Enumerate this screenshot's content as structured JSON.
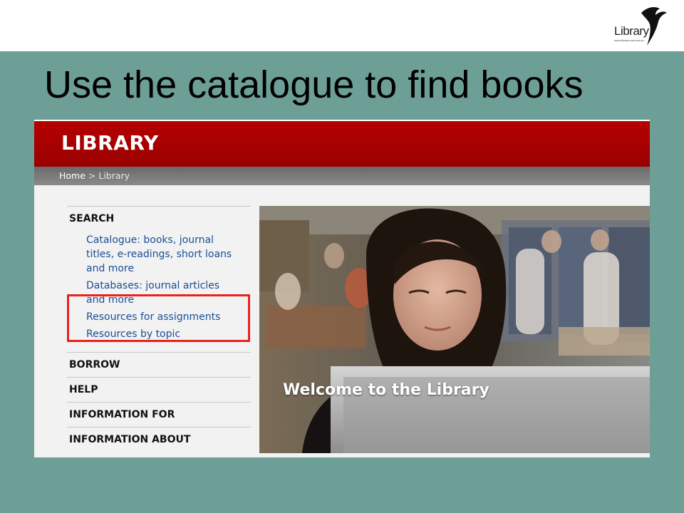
{
  "slide": {
    "title": "Use the catalogue to find books",
    "logo": {
      "text": "Library",
      "url": "www.library.uow.edu.au"
    }
  },
  "site": {
    "header": {
      "brand": "LIBRARY"
    },
    "breadcrumb": {
      "home": "Home",
      "separator": ">",
      "current": "Library"
    },
    "sidebar": {
      "search": {
        "heading": "SEARCH",
        "links": [
          {
            "lines": [
              "Catalogue: books, journal",
              "titles, e-readings, short loans",
              "and more"
            ]
          },
          {
            "lines": [
              "Databases: journal articles",
              "and more"
            ]
          },
          {
            "lines": [
              "Resources for assignments"
            ]
          },
          {
            "lines": [
              "Resources by topic"
            ]
          }
        ]
      },
      "sections": [
        "BORROW",
        "HELP",
        "INFORMATION FOR",
        "INFORMATION ABOUT"
      ]
    },
    "banner": {
      "caption": "Welcome to the Library"
    }
  },
  "colors": {
    "slide_background": "#6e9f96",
    "header_red": "#a80000",
    "link_blue": "#1a4f96",
    "highlight_red": "#e8231e"
  }
}
